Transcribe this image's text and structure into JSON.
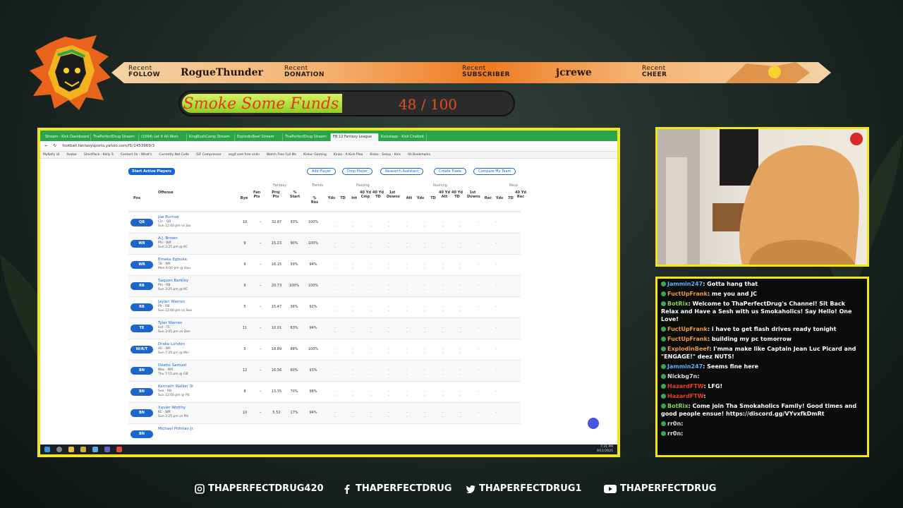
{
  "ribbon": {
    "follow_label1": "Recent",
    "follow_label2": "FOLLOW",
    "follow_name": "RogueThunder",
    "donation_label1": "Recent",
    "donation_label2": "DONATION",
    "subscriber_label1": "Recent",
    "subscriber_label2": "SUBSCRIBER",
    "subscriber_name": "jcrewe",
    "cheer_label1": "Recent",
    "cheer_label2": "CHEER"
  },
  "goal": {
    "title": "Smoke Some Funds",
    "current": 48,
    "target": 100,
    "display": "48 / 100"
  },
  "browser": {
    "tabs": [
      "Stream - Kick Dashboard",
      "ThaPerfectDrug Stream",
      "(1564) Let It All Work",
      "KingBushCamp Stream",
      "ExplodinBeef Stream",
      "ThaPerfectDrug Stream",
      "FB 12 Fantasy League",
      "Kickstapp - Kick Chatbot"
    ],
    "address": "football.fantasysports.yahoo.com/f1/1453969/3",
    "bookmarks": [
      "MyKelly UI",
      "Avatar",
      "ShortPack - Kelly S",
      "Contact Us - What's",
      "Currently Not Colle",
      "GIF Compressor",
      "esgif.com free onlin",
      "Watch Free Full Mo",
      "Kinko: Gaming",
      "Kinko - A Kick Plea",
      "Kinko - Setup - Kick",
      "All Bookmarks"
    ]
  },
  "fantasy": {
    "start_button": "Start Active Players",
    "actions": [
      "Add Player",
      "Drop Player",
      "Research Assistant",
      "Create Trade",
      "Compare My Team"
    ],
    "groups": [
      "Fantasy",
      "Trends",
      "Passing",
      "Rushing",
      "Rece"
    ],
    "headers": [
      "Pos",
      "Offense",
      "Bye",
      "Fan Pts",
      "Proj Pts",
      "% Start",
      "% Ros",
      "Yds",
      "TD",
      "Int",
      "40 Yd Cmp",
      "40 Yd TD",
      "1st Downs",
      "Att",
      "Yds",
      "TD",
      "40 Yd Att",
      "40 Yd TD",
      "1st Downs",
      "Rec",
      "Yds",
      "TD",
      "40 Yd Rec"
    ],
    "rows": [
      {
        "pos": "QB",
        "name": "Joe Burrow",
        "team": "Cin - QB",
        "game": "Sun 12:00 pm vs Jax",
        "bye": "10",
        "fan": "–",
        "proj": "32.87",
        "start": "93%",
        "ros": "100%"
      },
      {
        "pos": "WR",
        "name": "A.J. Brown",
        "team": "Phi - WR",
        "game": "Sun 3:25 pm @ KC",
        "bye": "9",
        "fan": "–",
        "proj": "15.23",
        "start": "90%",
        "ros": "100%"
      },
      {
        "pos": "WR",
        "name": "Emeka Egbuka",
        "team": "TB - WR",
        "game": "Mon 6:00 pm @ Hou",
        "bye": "9",
        "fan": "–",
        "proj": "16.15",
        "start": "59%",
        "ros": "94%"
      },
      {
        "pos": "RB",
        "name": "Saquon Barkley",
        "team": "Phi - RB",
        "game": "Sun 3:25 pm @ KC",
        "bye": "9",
        "fan": "–",
        "proj": "20.73",
        "start": "100%",
        "ros": "100%"
      },
      {
        "pos": "RB",
        "name": "Jaylen Warren",
        "team": "Pit - RB",
        "game": "Sun 12:00 pm vs Sea",
        "bye": "5",
        "fan": "–",
        "proj": "15.47",
        "start": "36%",
        "ros": "92%"
      },
      {
        "pos": "TE",
        "name": "Tyler Warren",
        "team": "Ind - TE",
        "game": "Sun 3:05 pm vs Den",
        "bye": "11",
        "fan": "–",
        "proj": "10.01",
        "start": "63%",
        "ros": "94%"
      },
      {
        "pos": "W/R/T",
        "name": "Drake London",
        "team": "Atl - WR",
        "game": "Sun 7:20 pm @ Min",
        "bye": "5",
        "fan": "–",
        "proj": "18.89",
        "start": "88%",
        "ros": "100%"
      },
      {
        "pos": "BN",
        "name": "Deebo Samuel",
        "team": "Was - WR",
        "game": "Thu 7:15 pm @ GB",
        "bye": "12",
        "fan": "–",
        "proj": "16.56",
        "start": "60%",
        "ros": "93%"
      },
      {
        "pos": "BN",
        "name": "Kenneth Walker III",
        "team": "Sea - RB",
        "game": "Sun 12:00 pm @ Pit",
        "bye": "8",
        "fan": "–",
        "proj": "13.35",
        "start": "70%",
        "ros": "98%"
      },
      {
        "pos": "BN",
        "name": "Xavier Worthy",
        "team": "KC - WR",
        "game": "Sun 3:25 pm vs Phi",
        "bye": "10",
        "fan": "–",
        "proj": "5.52",
        "start": "17%",
        "ros": "94%"
      },
      {
        "pos": "BN",
        "name": "Michael Pittman Jr.",
        "team": "",
        "game": "",
        "bye": "",
        "fan": "",
        "proj": "",
        "start": "",
        "ros": ""
      }
    ],
    "dashes": "- - - - - - - - - - - - - - - - - -"
  },
  "taskbar": {
    "time": "7:31 PM",
    "date": "9/11/2025"
  },
  "chat": [
    {
      "user": "Jammin247",
      "color": "b",
      "text": ": Gotta hang that"
    },
    {
      "user": "FuctUpFrank",
      "color": "o",
      "text": ": me you and JC"
    },
    {
      "user": "BotRix",
      "color": "g",
      "text": ": Welcome to ThaPerfectDrug's Channel! Sit Back Relax and Have a Sesh with us Smokaholics! Say Hello! One Love!"
    },
    {
      "user": "FuctUpFrank",
      "color": "o",
      "text": ": i have to get flash drives ready tonight"
    },
    {
      "user": "FuctUpFrank",
      "color": "o",
      "text": ": building my pc tomorrow"
    },
    {
      "user": "ExplodinBeef",
      "color": "o",
      "text": ": I'mma make like Captain Jean Luc Picard and \"ENGAGE!\" deez NUTS!"
    },
    {
      "user": "Jammin247",
      "color": "b",
      "text": ": Seems fine here"
    },
    {
      "user": "Nickbg7n",
      "color": "w",
      "text": ":"
    },
    {
      "user": "HazardFTW",
      "color": "r",
      "text": ": LFG!"
    },
    {
      "user": "HazardFTW",
      "color": "r",
      "text": ":"
    },
    {
      "user": "BotRix",
      "color": "g",
      "text": ": Come join Tha Smokaholics Family! Good times and good people ensue! https://discord.gg/VYvxfkDmRt"
    },
    {
      "user": "rr0n",
      "color": "w",
      "text": ":"
    },
    {
      "user": "rr0n",
      "color": "w",
      "text": ":"
    }
  ],
  "socials": {
    "instagram": "THAPERFECTDRUG420",
    "facebook": "THAPERFECTDRUG",
    "twitter": "THAPERFECTDRUG1",
    "youtube": "THAPERFECTDRUG"
  },
  "colors": {
    "frame": "#f1e716",
    "ribbon_mid": "#ee7a22",
    "goal_fill": "#8fce22",
    "goal_text": "#e03b14",
    "chat_user": "#8fd14f",
    "link": "#1566d6"
  }
}
